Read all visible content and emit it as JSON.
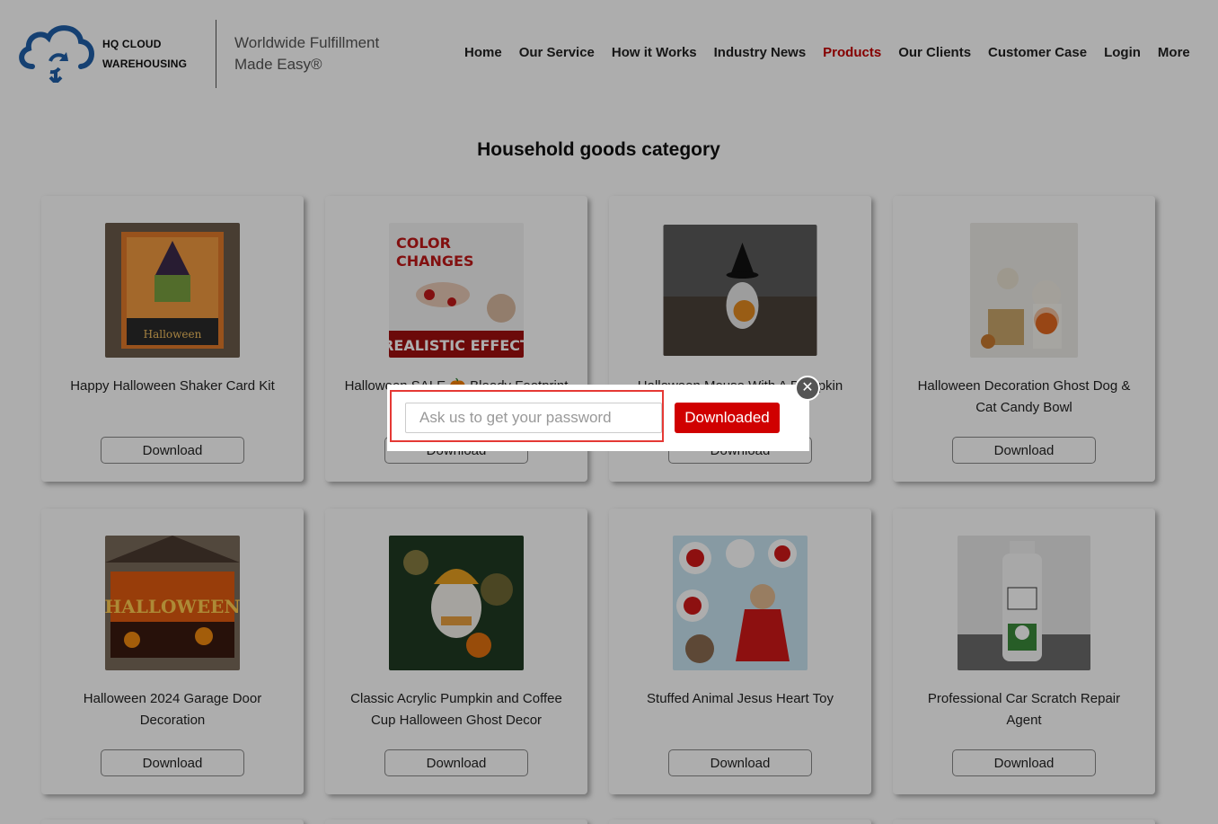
{
  "header": {
    "logo_line1": "HQ CLOUD",
    "logo_line2": "WAREHOUSING",
    "tagline_line1": "Worldwide Fulfillment",
    "tagline_line2": "Made Easy®",
    "nav": [
      {
        "label": "Home"
      },
      {
        "label": "Our Service"
      },
      {
        "label": "How it Works"
      },
      {
        "label": "Industry News"
      },
      {
        "label": "Products",
        "active": true
      },
      {
        "label": "Our Clients"
      },
      {
        "label": "Customer Case"
      },
      {
        "label": "Login"
      },
      {
        "label": "More"
      }
    ]
  },
  "section_title": "Household goods category",
  "products": [
    {
      "title": "Happy Halloween Shaker Card Kit",
      "button": "Download"
    },
    {
      "title": "Halloween SALE 🎃 Bloody Footprint",
      "button": "Download"
    },
    {
      "title": "Halloween Mouse With A Pumpkin",
      "button": "Download"
    },
    {
      "title": "Halloween Decoration Ghost Dog & Cat Candy Bowl",
      "button": "Download"
    },
    {
      "title": "Halloween 2024 Garage Door Decoration",
      "button": "Download"
    },
    {
      "title": "Classic Acrylic Pumpkin and Coffee Cup Halloween Ghost Decor",
      "button": "Download"
    },
    {
      "title": "Stuffed Animal Jesus Heart Toy",
      "button": "Download"
    },
    {
      "title": "Professional Car Scratch Repair Agent",
      "button": "Download"
    }
  ],
  "modal": {
    "input_placeholder": "Ask us to get your password",
    "submit_label": "Downloaded",
    "close_symbol": "✕"
  },
  "colors": {
    "accent": "#c40000",
    "button_red": "#d00000",
    "highlight_red": "#e53935",
    "logo_blue": "#1f5fa8"
  }
}
